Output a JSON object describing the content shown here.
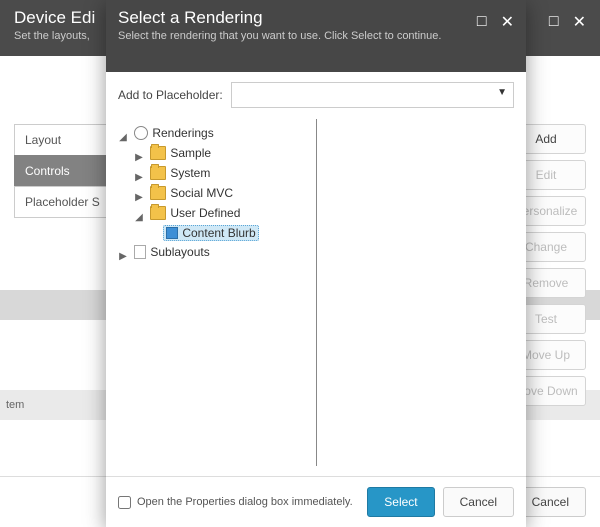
{
  "background": {
    "header": {
      "title": "Device Edi",
      "subtitle": "Set the layouts,"
    },
    "sidebar": {
      "items": [
        {
          "label": "Layout",
          "active": false
        },
        {
          "label": "Controls",
          "active": true
        },
        {
          "label": "Placeholder S",
          "active": false
        }
      ]
    },
    "rightButtons": [
      "Add",
      "Edit",
      "Personalize",
      "Change",
      "Remove",
      "Test",
      "Move Up",
      "Move Down"
    ],
    "listItem": "tem",
    "footer": {
      "cancel": "Cancel"
    }
  },
  "dialog": {
    "title": "Select a Rendering",
    "subtitle": "Select the rendering that you want to use. Click Select to continue.",
    "placeholderLabel": "Add to Placeholder:",
    "tree": {
      "root": {
        "label": "Renderings",
        "expanded": true
      },
      "children": [
        {
          "label": "Sample",
          "type": "folder",
          "expanded": false
        },
        {
          "label": "System",
          "type": "folder",
          "expanded": false
        },
        {
          "label": "Social MVC",
          "type": "folder",
          "expanded": false
        },
        {
          "label": "User Defined",
          "type": "folder",
          "expanded": true,
          "children": [
            {
              "label": "Content Blurb",
              "type": "block",
              "selected": true
            }
          ]
        }
      ],
      "sibling": {
        "label": "Sublayouts",
        "type": "page",
        "expanded": false
      }
    },
    "openPropsLabel": "Open the Properties dialog box immediately.",
    "selectLabel": "Select",
    "cancelLabel": "Cancel"
  }
}
